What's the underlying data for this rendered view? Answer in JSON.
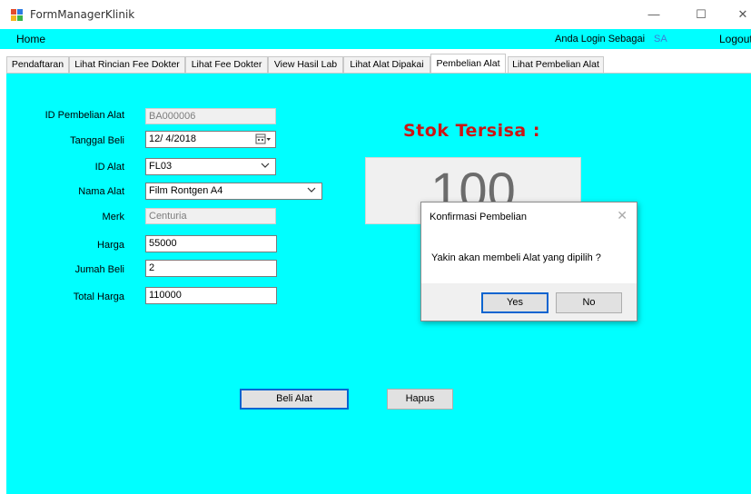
{
  "window": {
    "title": "FormManagerKlinik",
    "minimize": "—",
    "maximize": "☐",
    "close": "✕"
  },
  "menu": {
    "home": "Home",
    "login_label": "Anda Login Sebagai",
    "login_user": "SA",
    "logout": "Logout"
  },
  "tabs": [
    {
      "label": "Pendaftaran"
    },
    {
      "label": "Lihat Rincian Fee Dokter"
    },
    {
      "label": "Lihat Fee Dokter"
    },
    {
      "label": "View Hasil Lab"
    },
    {
      "label": "Lihat Alat Dipakai"
    },
    {
      "label": "Pembelian Alat",
      "active": true
    },
    {
      "label": "Lihat Pembelian Alat"
    }
  ],
  "form": {
    "id_label": "ID Pembelian Alat",
    "id_value": "BA000006",
    "tanggal_label": "Tanggal Beli",
    "tanggal_value": "12/ 4/2018",
    "id_alat_label": "ID Alat",
    "id_alat_value": "FL03",
    "nama_label": "Nama Alat",
    "nama_value": "Film Rontgen A4",
    "merk_label": "Merk",
    "merk_value": "Centuria",
    "harga_label": "Harga",
    "harga_value": "55000",
    "jumlah_label": "Jumah Beli",
    "jumlah_value": "2",
    "total_label": "Total Harga",
    "total_value": "110000"
  },
  "stok": {
    "title": "Stok Tersisa :",
    "value": "100"
  },
  "buttons": {
    "beli": "Beli Alat",
    "hapus": "Hapus"
  },
  "dialog": {
    "title": "Konfirmasi Pembelian",
    "close": "✕",
    "message": "Yakin akan membeli Alat yang dipilih ?",
    "yes": "Yes",
    "no": "No"
  },
  "colors": {
    "panel_bg": "#00ffff",
    "stok_title": "#cc1414",
    "user_highlight": "#3c7dd6"
  }
}
